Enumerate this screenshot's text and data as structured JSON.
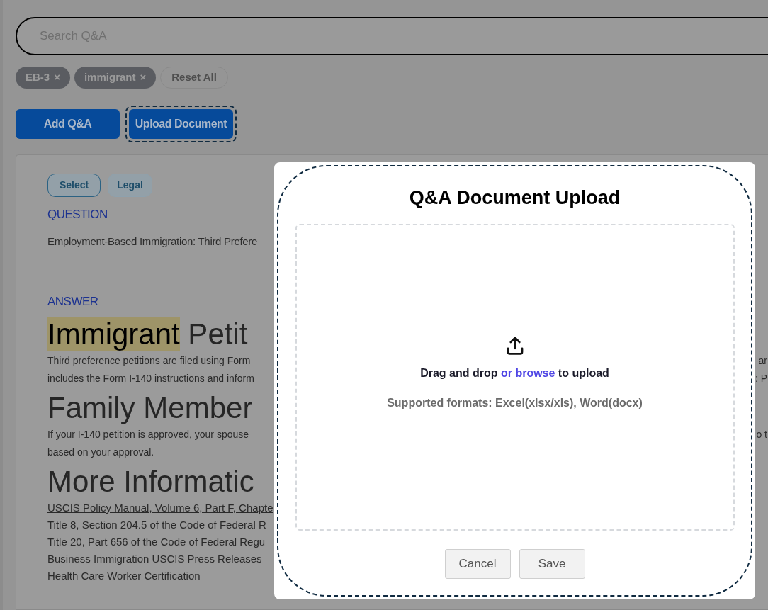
{
  "search": {
    "placeholder": "Search Q&A"
  },
  "filters": [
    {
      "label": "EB-3",
      "remove": "×"
    },
    {
      "label": "immigrant",
      "remove": "×"
    }
  ],
  "reset_button": "Reset All",
  "actions": [
    {
      "label": "Add Q&A",
      "focused": false
    },
    {
      "label": "Upload Document",
      "focused": true
    }
  ],
  "card": {
    "tags": [
      {
        "label": "Select",
        "selected": true
      },
      {
        "label": "Legal",
        "selected": false
      }
    ],
    "question_label": "QUESTION",
    "question": "Employment-Based Immigration: Third Prefere",
    "answer_label": "ANSWER",
    "answer": [
      {
        "kind": "heading",
        "highlight": "Immigrant",
        "text": " Petit"
      },
      {
        "kind": "para",
        "text": "Third preference petitions are filed using Form",
        "right": "ar"
      },
      {
        "kind": "para",
        "text": "includes the Form I-140 instructions and inform",
        "right": ": P"
      },
      {
        "kind": "heading",
        "text": "Family Member"
      },
      {
        "kind": "para",
        "text": "If your I-140 petition is approved, your spouse",
        "right": "o t"
      },
      {
        "kind": "para",
        "text": "based on your approval."
      },
      {
        "kind": "heading",
        "text": "More Informatic"
      },
      {
        "kind": "link",
        "text": "USCIS Policy Manual, Volume 6, Part F, Chapte"
      },
      {
        "kind": "item",
        "text": "Title 8, Section 204.5 of the Code of Federal R"
      },
      {
        "kind": "item",
        "text": "Title 20, Part 656 of the Code of Federal Regu"
      },
      {
        "kind": "item",
        "text": "Business Immigration USCIS Press Releases"
      },
      {
        "kind": "item",
        "text": "Health Care Worker Certification"
      }
    ]
  },
  "modal": {
    "title": "Q&A Document Upload",
    "drop_text": "Drag and drop",
    "browse_link": "or browse",
    "drop_text_end": "to upload",
    "formats": "Supported formats: Excel(xlsx/xls), Word(docx)",
    "buttons": [
      "Cancel",
      "Save"
    ]
  }
}
